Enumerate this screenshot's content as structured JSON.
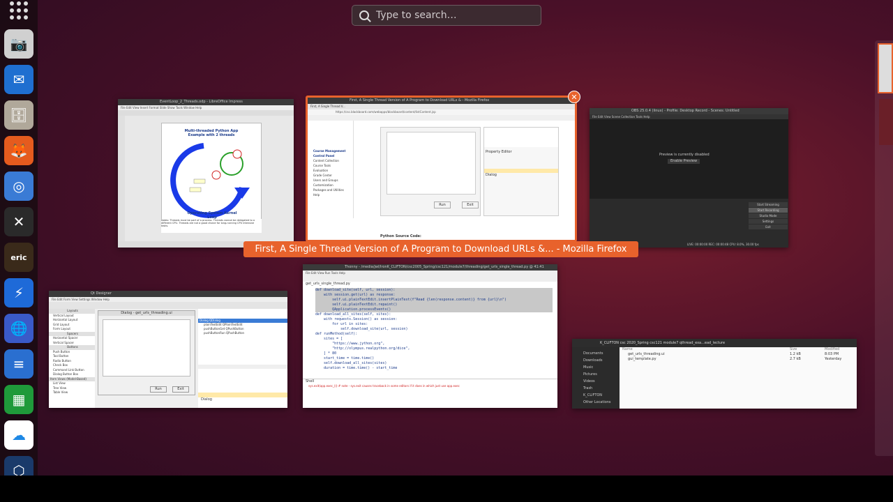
{
  "search": {
    "placeholder": "Type to search…"
  },
  "dock": {
    "apps": [
      {
        "name": "camera",
        "color": "#d0d0d0",
        "glyph": "📷"
      },
      {
        "name": "thunderbird",
        "color": "#1f6fd0",
        "glyph": "✉"
      },
      {
        "name": "files",
        "color": "#b0a89a",
        "glyph": "🗄"
      },
      {
        "name": "firefox",
        "color": "#e55b1e",
        "glyph": "🦊"
      },
      {
        "name": "chromium",
        "color": "#3a7bd5",
        "glyph": "◎"
      },
      {
        "name": "xmind",
        "color": "#2a2a2a",
        "glyph": "✕"
      },
      {
        "name": "eric",
        "color": "#3a2a1a",
        "glyph": "eric"
      },
      {
        "name": "messenger",
        "color": "#1e6ad8",
        "glyph": "⚡"
      },
      {
        "name": "globe",
        "color": "#3a5ac8",
        "glyph": "🌐"
      },
      {
        "name": "writer",
        "color": "#2a6fd0",
        "glyph": "≡"
      },
      {
        "name": "calc",
        "color": "#1f9a3a",
        "glyph": "▦"
      },
      {
        "name": "cloud",
        "color": "#ffffff",
        "glyph": "☁"
      },
      {
        "name": "virtualbox",
        "color": "#1a3a6a",
        "glyph": "⬡"
      }
    ]
  },
  "windows": {
    "impress": {
      "title": "EventLoop_2_Threads.odp - LibreOffice Impress",
      "slide_title": "Multi-threaded Python App Example with 2 threads",
      "caption": "Operating System Kernel Loop",
      "notes": "Notes: Threads must be part of a process. Threads cannot be delegated to a different CPU. Threads are not a good choice for long-running CPU intensive tasks."
    },
    "firefox": {
      "title": "First, A Single Thread Version of A Program to Download URLs & - Mozilla Firefox",
      "url": "https://csc.blackboard.com/webapps/blackboard/content/listContent.jsp",
      "sidebar": [
        "Course Management",
        "Control Panel",
        "Content Collection",
        "Course Tools",
        "Evaluation",
        "Grade Center",
        "Users and Groups",
        "Customization",
        "Packages and Utilities",
        "Help"
      ],
      "run": "Run",
      "exit": "Exit",
      "property_editor": "Property Editor",
      "object_name": "Dialog",
      "source_label": "Python Source Code:"
    },
    "obs": {
      "title": "OBS 25.0.4 (linux) - Profile: Desktop Record - Scenes: Untitled",
      "preview": "Preview is currently disabled",
      "enable_preview": "Enable Preview",
      "controls": [
        "Start Streaming",
        "Start Recording",
        "Studio Mode",
        "Settings",
        "Exit"
      ],
      "status": "LIVE: 00:00:00   REC: 00:00:48   CPU: 8.0%, 30.00 fps"
    },
    "qtdesigner": {
      "title": "Qt Designer",
      "form_title": "Dialog - get_urls_threading.ui",
      "widget_box": [
        "Layouts",
        "Vertical Layout",
        "Horizontal Layout",
        "Grid Layout",
        "Form Layout",
        "Spacers",
        "Horizontal Spacer",
        "Vertical Spacer",
        "Buttons",
        "Push Button",
        "Tool Button",
        "Radio Button",
        "Check Box",
        "Command Link Button",
        "Dialog Button Box",
        "Item Views (Model-Based)",
        "List View",
        "Tree View",
        "Table View"
      ],
      "objects": [
        "Dialog",
        "plainTextEdit",
        "pushButtonGet",
        "pushButtonRun"
      ],
      "classes": [
        "QDialog",
        "QPlainTextEdit",
        "QPushButton",
        "QPushButton"
      ],
      "run": "Run",
      "exit": "Exit",
      "object_name": "Dialog"
    },
    "thonny": {
      "title": "Thonny - /media/jwl/IronK_CLIFTON/csc2005_Spring/csc121/module7/threading/get_urls_single_thread.py @ 41:41",
      "tab": "get_urls_single_thread.py",
      "code": [
        "def download_site(self, url, session):",
        "    with session.get(url) as response:",
        "        self.ui.plainTextEdit.insertPlainText(f\"Read {len(response.content)} from {url}\\n\")",
        "        self.ui.plainTextEdit.repaint()",
        "        QApplication.processEvents()",
        "",
        "def download_all_sites(self, sites):",
        "    with requests.Session() as session:",
        "        for url in sites:",
        "            self.download_site(url, session)",
        "",
        "def runMethod(self):",
        "    sites = [",
        "        \"https://www.jython.org\",",
        "        \"http://olympus.realpython.org/dice\",",
        "    ] * 80",
        "    start_time = time.time()",
        "    self.download_all_sites(sites)",
        "    duration = time.time() - start_time"
      ],
      "shell": "Shell",
      "traceback": "sys.exit(app.exec_())  # note - sys.exit causes traceback in some editors if it does in which just use app.exec"
    },
    "files": {
      "breadcrumb": [
        "K_CLIFTON",
        "csc",
        "2020_Spring",
        "csc121",
        "module7",
        "qthread_exa...ead_lecture"
      ],
      "places": [
        "Documents",
        "Downloads",
        "Music",
        "Pictures",
        "Videos",
        "Trash",
        "K_CLIFTON",
        "Other Locations"
      ],
      "columns": [
        "Name",
        "Size",
        "Modified"
      ],
      "rows": [
        {
          "name": "get_urls_threading.ui",
          "size": "1.2 kB",
          "modified": "8:03 PM"
        },
        {
          "name": "gui_template.py",
          "size": "2.7 kB",
          "modified": "Yesterday"
        }
      ]
    }
  },
  "caption": "First, A Single Thread Version of A Program to Download URLs &... - Mozilla Firefox"
}
